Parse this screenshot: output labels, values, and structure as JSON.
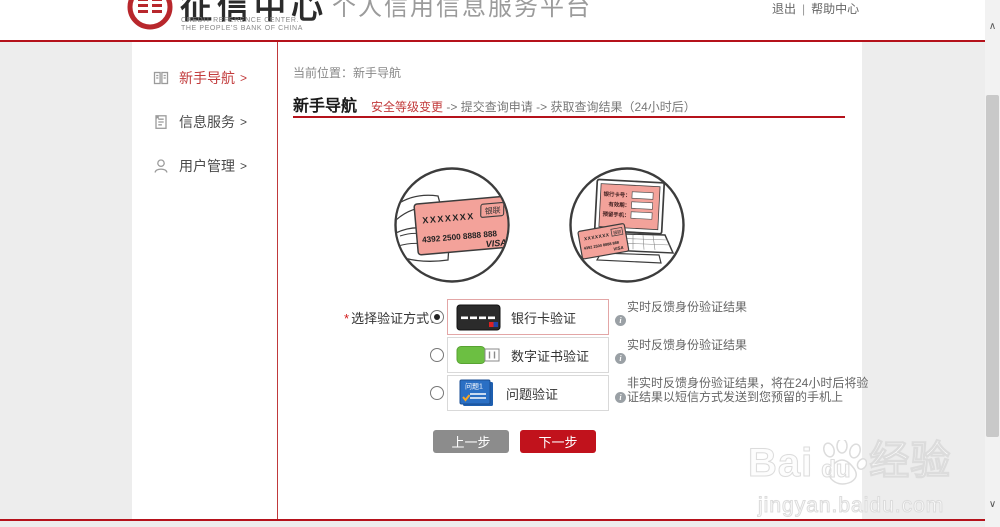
{
  "header": {
    "logo_cn": "征信中心",
    "logo_en_line1": "CREDIT  REFERENCE  CENTER.",
    "logo_en_line2": "THE PEOPLE'S  BANK  OF CHINA",
    "site_title": "个人信用信息服务平台",
    "logout": "退出",
    "link_divider": "|",
    "help": "帮助中心"
  },
  "sidebar": {
    "items": [
      {
        "label": "新手导航",
        "arrow": ">",
        "active": true
      },
      {
        "label": "信息服务",
        "arrow": ">",
        "active": false
      },
      {
        "label": "用户管理",
        "arrow": ">",
        "active": false
      }
    ]
  },
  "main": {
    "breadcrumb": "当前位置：新手导航",
    "section_title": "新手导航",
    "steps": {
      "step1": "安全等级变更",
      "sep1": "->",
      "step2": "提交查询申请",
      "sep2": "->",
      "step3": "获取查询结果（24小时后）"
    }
  },
  "illustration": {
    "masked_number": "XXXXXXX",
    "brand": "银联",
    "card_number": "4392 2500 8888 888",
    "network": "VISA",
    "field_card_no": "银行卡号：",
    "field_expiry": "有效期：",
    "field_phone": "预留手机："
  },
  "form": {
    "required_mark": "*",
    "label": "选择验证方式：",
    "options": [
      {
        "name": "银行卡验证",
        "selected": true,
        "desc": "实时反馈身份验证结果"
      },
      {
        "name": "数字证书验证",
        "selected": false,
        "desc": "实时反馈身份验证结果"
      },
      {
        "name": "问题验证",
        "selected": false,
        "icon_label": "问题1",
        "desc_line1": "非实时反馈身份验证结果，将在24小时后将验",
        "desc_line2": "证结果以短信方式发送到您预留的手机上"
      }
    ],
    "prev_button": "上一步",
    "next_button": "下一步"
  },
  "watermark": {
    "bai": "Bai",
    "du": "du",
    "cn": "经验",
    "url": "jingyan.baidu.com"
  },
  "icons": {
    "info": "i",
    "scroll_up": "∧",
    "scroll_down": "∨"
  },
  "colors": {
    "accent_red": "#b5121b",
    "active_red": "#c23b3c",
    "selected_option_border": "#e3a6a6",
    "card_pink": "#f3a29a",
    "usb_green": "#6cbf42",
    "question_blue": "#2a6fc4",
    "prev_button_gray": "#8c8c8c",
    "next_button_red": "#c1121c"
  }
}
